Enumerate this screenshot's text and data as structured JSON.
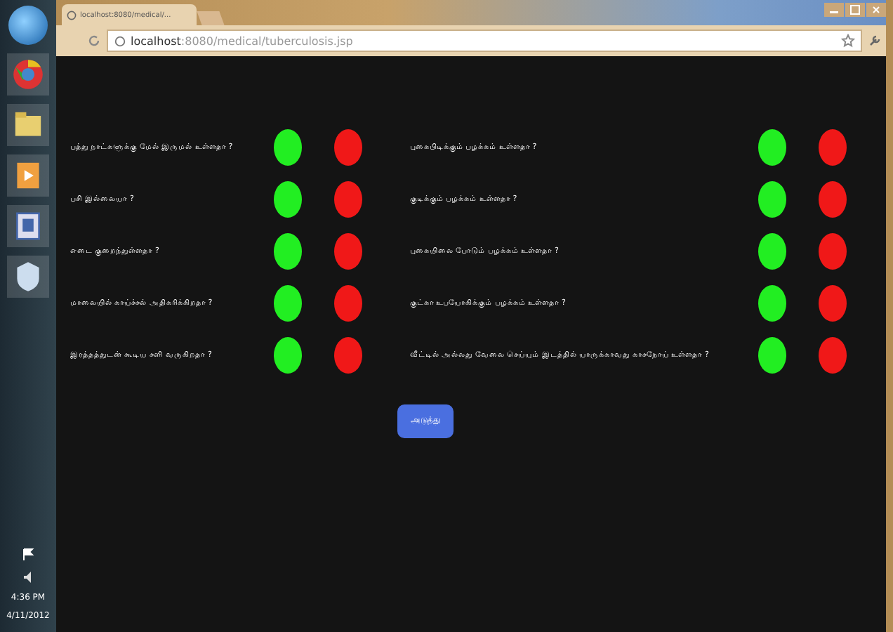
{
  "taskbar": {
    "clock_time": "4:36 PM",
    "clock_date": "4/11/2012"
  },
  "browser": {
    "tab_title": "localhost:8080/medical/...",
    "url_host": "localhost",
    "url_path": ":8080/medical/tuberculosis.jsp"
  },
  "columns": [
    {
      "questions": [
        {
          "text": "பத்து நாட்களுக்கு மேல் இருமல் உள்ளதா ?",
          "options": [
            {
              "kind": "yes"
            },
            {
              "kind": "no"
            }
          ]
        },
        {
          "text": "பசி இல்லையா ?",
          "options": [
            {
              "kind": "yes"
            },
            {
              "kind": "no"
            }
          ]
        },
        {
          "text": "எடை குறைந்துள்ளதா ?",
          "options": [
            {
              "kind": "yes"
            },
            {
              "kind": "no"
            }
          ]
        },
        {
          "text": "மாலையில் காய்ச்சல் அதிகரிக்கிறதா ?",
          "options": [
            {
              "kind": "yes"
            },
            {
              "kind": "no"
            }
          ]
        },
        {
          "text": "இரத்தத்துடன் கூடிய சளி வருகிறதா ?",
          "options": [
            {
              "kind": "yes"
            },
            {
              "kind": "no"
            }
          ]
        }
      ]
    },
    {
      "questions": [
        {
          "text": "புகைபிடிக்கும் பழக்கம் உள்ளதா ?",
          "options": [
            {
              "kind": "yes"
            },
            {
              "kind": "no"
            }
          ]
        },
        {
          "text": "குடிக்கும் பழக்கம் உள்ளதா ?",
          "options": [
            {
              "kind": "yes"
            },
            {
              "kind": "no"
            }
          ]
        },
        {
          "text": "புகையிலை போடும் பழக்கம் உள்ளதா ?",
          "options": [
            {
              "kind": "yes"
            },
            {
              "kind": "no"
            }
          ]
        },
        {
          "text": "குட்கா உபயோகிக்கும் பழக்கம் உள்ளதா ?",
          "options": [
            {
              "kind": "yes"
            },
            {
              "kind": "no"
            }
          ]
        },
        {
          "text": "வீட்டில் அல்லது வேலை செய்யும் இடத்தில் யாருக்காவது காசநோய் உள்ளதா ?",
          "options": [
            {
              "kind": "yes"
            },
            {
              "kind": "no"
            }
          ]
        }
      ]
    }
  ],
  "next_button": "அடுத்து"
}
